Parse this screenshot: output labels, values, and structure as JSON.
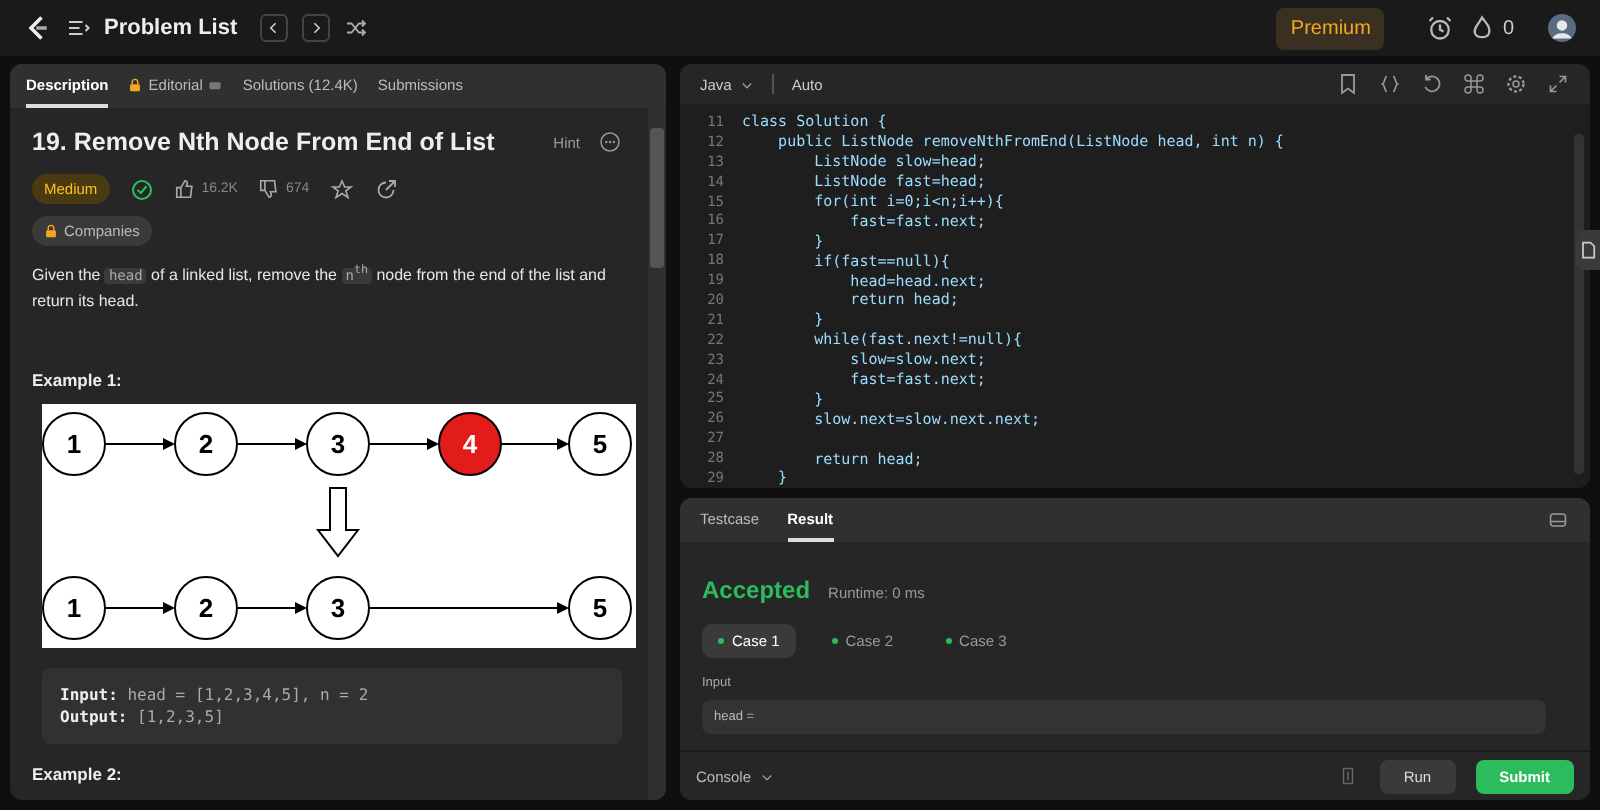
{
  "topbar": {
    "title": "Problem List",
    "premium": "Premium",
    "streak": "0"
  },
  "tabs": [
    {
      "label": "Description",
      "selected": true,
      "kind": "plain"
    },
    {
      "label": "Editorial",
      "selected": false,
      "kind": "locked"
    },
    {
      "label": "Solutions (12.4K)",
      "selected": false,
      "kind": "plain"
    },
    {
      "label": "Submissions",
      "selected": false,
      "kind": "plain"
    }
  ],
  "problem": {
    "title": "19. Remove Nth Node From End of List",
    "hint": "Hint",
    "difficulty": "Medium",
    "solved": true,
    "likes": "16.2K",
    "dislikes": "674",
    "companies": "Companies",
    "description": [
      {
        "kind": "text",
        "text": "Given the "
      },
      {
        "kind": "code",
        "text": "head"
      },
      {
        "kind": "text",
        "text": " of a linked list, remove the "
      },
      {
        "kind": "code",
        "text": "n$^{th}$"
      },
      {
        "kind": "text",
        "text": " node from the end of the list and return its head."
      }
    ],
    "examples": [
      {
        "title": "Example 1:",
        "before": [
          {
            "label": "1",
            "removed": false
          },
          {
            "label": "2",
            "removed": false
          },
          {
            "label": "3",
            "removed": false
          },
          {
            "label": "4",
            "removed": true
          },
          {
            "label": "5",
            "removed": false
          }
        ],
        "after": [
          {
            "label": "1",
            "removed": false
          },
          {
            "label": "2",
            "removed": false
          },
          {
            "label": "3",
            "removed": false
          },
          {
            "label": "5",
            "removed": false
          }
        ],
        "input_label": "Input:",
        "input": "head = [1,2,3,4,5], n = 2",
        "output_label": "Output:",
        "output": "[1,2,3,5]"
      },
      {
        "title": "Example 2:"
      }
    ]
  },
  "editor": {
    "language": "Java",
    "mode": "Auto",
    "lines": [
      {
        "n": "11",
        "code": "class Solution {"
      },
      {
        "n": "12",
        "code": "    public ListNode removeNthFromEnd(ListNode head, int n) {"
      },
      {
        "n": "13",
        "code": "        ListNode slow=head;"
      },
      {
        "n": "14",
        "code": "        ListNode fast=head;"
      },
      {
        "n": "15",
        "code": "        for(int i=0;i<n;i++){"
      },
      {
        "n": "16",
        "code": "            fast=fast.next;"
      },
      {
        "n": "17",
        "code": "        }"
      },
      {
        "n": "18",
        "code": "        if(fast==null){"
      },
      {
        "n": "19",
        "code": "            head=head.next;"
      },
      {
        "n": "20",
        "code": "            return head;"
      },
      {
        "n": "21",
        "code": "        }"
      },
      {
        "n": "22",
        "code": "        while(fast.next!=null){"
      },
      {
        "n": "23",
        "code": "            slow=slow.next;"
      },
      {
        "n": "24",
        "code": "            fast=fast.next;"
      },
      {
        "n": "25",
        "code": "        }"
      },
      {
        "n": "26",
        "code": "        slow.next=slow.next.next;"
      },
      {
        "n": "27"
      },
      {
        "n": "28",
        "code": "        return head;"
      },
      {
        "n": "29",
        "code": "    }"
      }
    ]
  },
  "console": {
    "tabs": [
      {
        "label": "Testcase",
        "selected": false
      },
      {
        "label": "Result",
        "selected": true
      }
    ],
    "status": "Accepted",
    "runtime": "Runtime: 0 ms",
    "cases": [
      {
        "label": "Case 1",
        "selected": true
      },
      {
        "label": "Case 2",
        "selected": false
      },
      {
        "label": "Case 3",
        "selected": false
      }
    ],
    "input_label": "Input",
    "input_value": "head =",
    "console_label": "Console",
    "run": "Run",
    "submit": "Submit"
  }
}
